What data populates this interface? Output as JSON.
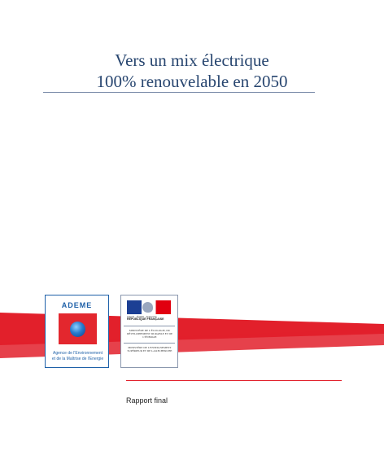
{
  "title_line1": "Vers un mix électrique",
  "title_line2": "100% renouvelable en 2050",
  "ademe": {
    "name": "ADEME",
    "caption_line1": "Agence de l'Environnement",
    "caption_line2": "et de la Maîtrise de l'Energie"
  },
  "republique": {
    "motto": "Liberté · Égalité · Fraternité",
    "name": "RÉPUBLIQUE FRANÇAISE",
    "ministry1": "MINISTÈRE DE L'ÉCOLOGIE, DU DÉVELOPPEMENT DURABLE ET DE L'ÉNERGIE",
    "ministry2": "MINISTÈRE DE L'ENSEIGNEMENT SUPÉRIEUR ET DE LA RECHERCHE"
  },
  "subtitle": "Rapport final",
  "colors": {
    "title": "#27456f",
    "band_red": "#e2202b",
    "ademe_blue": "#1e60a8"
  }
}
